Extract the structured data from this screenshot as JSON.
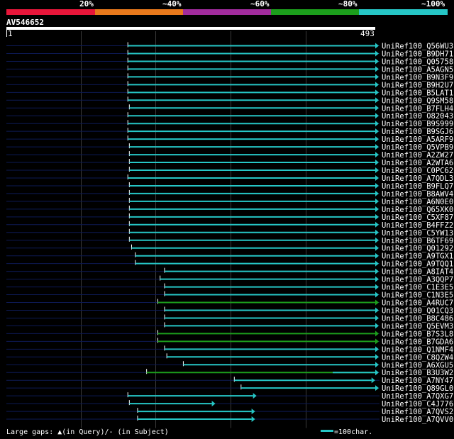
{
  "legend": {
    "labels": [
      "20%",
      "~40%",
      "~60%",
      "~80%",
      "~100%"
    ],
    "colors": [
      "#e8163a",
      "#e8791c",
      "#a12b9c",
      "#1c9e1c",
      "#26c6c6"
    ]
  },
  "query": {
    "name": "AV546652",
    "start": "1",
    "end": "493",
    "length": 493
  },
  "colors": {
    "background": "#000000",
    "query_line": "#0d1a55",
    "grid": "#3a3a3a",
    "cyan": "#26c6c6",
    "green": "#1c9e1c"
  },
  "hits": [
    {
      "name": "UniRef100_Q56WU3",
      "start": 163,
      "end": 493,
      "arrow": true,
      "color": "cyan"
    },
    {
      "name": "UniRef100_B9DH71",
      "start": 163,
      "end": 493,
      "arrow": true,
      "color": "cyan"
    },
    {
      "name": "UniRef100_Q05758",
      "start": 163,
      "end": 493,
      "arrow": true,
      "color": "cyan"
    },
    {
      "name": "UniRef100_A5AGN5",
      "start": 163,
      "end": 493,
      "arrow": true,
      "color": "cyan"
    },
    {
      "name": "UniRef100_B9N3F9",
      "start": 163,
      "end": 493,
      "arrow": true,
      "color": "cyan"
    },
    {
      "name": "UniRef100_B9H2U7",
      "start": 163,
      "end": 493,
      "arrow": true,
      "color": "cyan"
    },
    {
      "name": "UniRef100_B5LAT1",
      "start": 163,
      "end": 493,
      "arrow": true,
      "color": "cyan"
    },
    {
      "name": "UniRef100_Q9SM58",
      "start": 163,
      "end": 493,
      "arrow": true,
      "color": "cyan"
    },
    {
      "name": "UniRef100_B7FLH4",
      "start": 165,
      "end": 493,
      "arrow": true,
      "color": "cyan"
    },
    {
      "name": "UniRef100_O82043",
      "start": 163,
      "end": 493,
      "arrow": true,
      "color": "cyan"
    },
    {
      "name": "UniRef100_B9S999",
      "start": 163,
      "end": 493,
      "arrow": true,
      "color": "cyan"
    },
    {
      "name": "UniRef100_B9SGJ6",
      "start": 163,
      "end": 493,
      "arrow": true,
      "color": "cyan"
    },
    {
      "name": "UniRef100_A5ARF9",
      "start": 163,
      "end": 493,
      "arrow": true,
      "color": "cyan"
    },
    {
      "name": "UniRef100_Q5VPB9",
      "start": 165,
      "end": 493,
      "arrow": true,
      "color": "cyan"
    },
    {
      "name": "UniRef100_A2ZW27",
      "start": 165,
      "end": 493,
      "arrow": true,
      "color": "cyan"
    },
    {
      "name": "UniRef100_A2WTA6",
      "start": 165,
      "end": 493,
      "arrow": true,
      "color": "cyan"
    },
    {
      "name": "UniRef100_C0PC62",
      "start": 165,
      "end": 493,
      "arrow": true,
      "color": "cyan"
    },
    {
      "name": "UniRef100_A7QDL3",
      "start": 163,
      "end": 493,
      "arrow": true,
      "color": "cyan"
    },
    {
      "name": "UniRef100_B9FLQ7",
      "start": 165,
      "end": 493,
      "arrow": true,
      "color": "cyan"
    },
    {
      "name": "UniRef100_B8AWV4",
      "start": 165,
      "end": 493,
      "arrow": true,
      "color": "cyan"
    },
    {
      "name": "UniRef100_A6N0E0",
      "start": 165,
      "end": 493,
      "arrow": true,
      "color": "cyan"
    },
    {
      "name": "UniRef100_Q65XK0",
      "start": 165,
      "end": 493,
      "arrow": true,
      "color": "cyan"
    },
    {
      "name": "UniRef100_C5XF87",
      "start": 165,
      "end": 493,
      "arrow": true,
      "color": "cyan"
    },
    {
      "name": "UniRef100_B4FFZ2",
      "start": 165,
      "end": 493,
      "arrow": true,
      "color": "cyan"
    },
    {
      "name": "UniRef100_C5YW13",
      "start": 165,
      "end": 493,
      "arrow": true,
      "color": "cyan"
    },
    {
      "name": "UniRef100_B6TF69",
      "start": 165,
      "end": 493,
      "arrow": true,
      "color": "cyan"
    },
    {
      "name": "UniRef100_Q01292",
      "start": 168,
      "end": 493,
      "arrow": true,
      "color": "cyan"
    },
    {
      "name": "UniRef100_A9TGX1",
      "start": 173,
      "end": 493,
      "arrow": true,
      "color": "cyan"
    },
    {
      "name": "UniRef100_A9TQQ1",
      "start": 173,
      "end": 493,
      "arrow": true,
      "color": "cyan"
    },
    {
      "name": "UniRef100_A8IAT4",
      "start": 212,
      "end": 493,
      "arrow": true,
      "color": "cyan"
    },
    {
      "name": "UniRef100_A3QQP7",
      "start": 206,
      "end": 493,
      "arrow": true,
      "color": "cyan"
    },
    {
      "name": "UniRef100_C1E3E5",
      "start": 212,
      "end": 493,
      "arrow": true,
      "color": "cyan"
    },
    {
      "name": "UniRef100_C1N3E5",
      "start": 212,
      "end": 493,
      "arrow": true,
      "color": "cyan"
    },
    {
      "name": "UniRef100_A4RUC7",
      "start": 203,
      "end": 493,
      "arrow": true,
      "color": "green"
    },
    {
      "name": "UniRef100_Q01CQ3",
      "start": 212,
      "end": 493,
      "arrow": true,
      "color": "cyan"
    },
    {
      "name": "UniRef100_B8C486",
      "start": 212,
      "end": 493,
      "arrow": true,
      "color": "cyan"
    },
    {
      "name": "UniRef100_Q5EVM3",
      "start": 212,
      "end": 493,
      "arrow": true,
      "color": "cyan"
    },
    {
      "name": "UniRef100_B7S3L8",
      "start": 203,
      "end": 493,
      "arrow": true,
      "color": "green"
    },
    {
      "name": "UniRef100_B7GDA6",
      "start": 203,
      "end": 493,
      "arrow": true,
      "color": "green"
    },
    {
      "name": "UniRef100_Q1NMF4",
      "start": 212,
      "end": 493,
      "arrow": true,
      "color": "cyan"
    },
    {
      "name": "UniRef100_C8QZW4",
      "start": 215,
      "end": 493,
      "arrow": true,
      "color": "cyan"
    },
    {
      "name": "UniRef100_A6XGU5",
      "start": 237,
      "end": 493,
      "arrow": true,
      "color": "cyan"
    },
    {
      "name": "UniRef100_B3U3W2",
      "start": 188,
      "end": 493,
      "arrow": true,
      "color": "green",
      "tail": true
    },
    {
      "name": "UniRef100_A7NY47",
      "start": 305,
      "end": 488,
      "arrow": true,
      "color": "cyan"
    },
    {
      "name": "UniRef100_Q89GL0",
      "start": 314,
      "end": 493,
      "arrow": true,
      "color": "cyan"
    },
    {
      "name": "UniRef100_A7QXG7",
      "start": 163,
      "end": 330,
      "arrow": true,
      "color": "cyan"
    },
    {
      "name": "UniRef100_C4J776",
      "start": 165,
      "end": 275,
      "arrow": true,
      "color": "cyan"
    },
    {
      "name": "UniRef100_A7QVS2",
      "start": 176,
      "end": 328,
      "arrow": true,
      "color": "cyan"
    },
    {
      "name": "UniRef100_A7QVV0",
      "start": 176,
      "end": 328,
      "arrow": true,
      "color": "cyan"
    }
  ],
  "footer": {
    "note": "Large gaps: ▲(in Query)/- (in Subject)",
    "scale_label": "=100char."
  }
}
